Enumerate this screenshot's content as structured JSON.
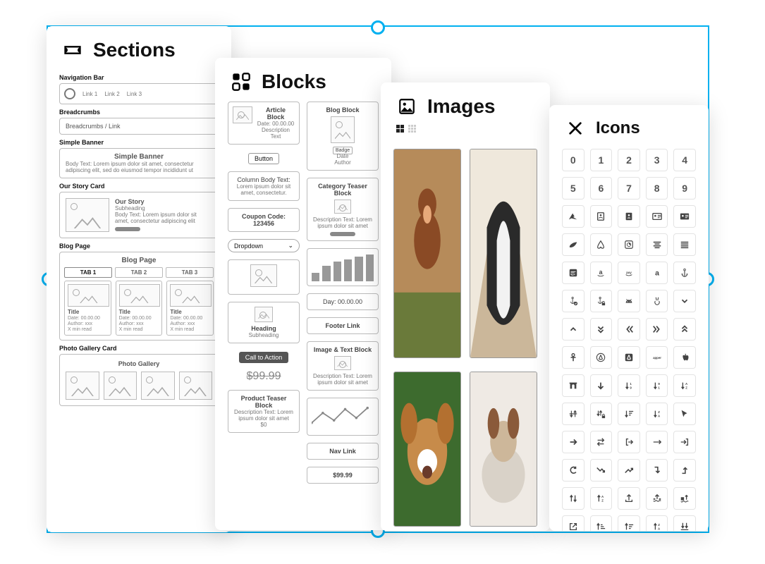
{
  "panels": {
    "sections": {
      "title": "Sections"
    },
    "blocks": {
      "title": "Blocks"
    },
    "images": {
      "title": "Images"
    },
    "icons": {
      "title": "Icons"
    }
  },
  "sections": {
    "nav": {
      "label": "Navigation Bar",
      "links": [
        "Link 1",
        "Link 2",
        "Link 3"
      ]
    },
    "breadcrumbs": {
      "label": "Breadcrumbs",
      "text": "Breadcrumbs / Link"
    },
    "banner": {
      "label": "Simple Banner",
      "heading": "Simple Banner",
      "body": "Body Text: Lorem ipsum dolor sit amet, consectetur adipiscing elit, sed do eiusmod tempor incididunt ut"
    },
    "story": {
      "label": "Our Story Card",
      "heading": "Our Story",
      "sub": "Subheading",
      "body": "Body Text: Lorem ipsum dolor sit amet, consectetur adipiscing elit"
    },
    "blog": {
      "label": "Blog Page",
      "heading": "Blog Page",
      "tabs": [
        "TAB 1",
        "TAB 2",
        "TAB 3"
      ],
      "card": {
        "title": "Title",
        "date": "Date: 00.00.00",
        "author": "Author: xxx",
        "read": "X min read"
      }
    },
    "gallery": {
      "label": "Photo Gallery Card",
      "heading": "Photo Gallery"
    }
  },
  "blocks": {
    "article": {
      "title": "Article Block",
      "date": "Date: 00.00.00",
      "desc": "Description Text"
    },
    "button": "Button",
    "column": {
      "title": "Column Body Text:",
      "body": "Lorem ipsum dolor sit amet, consectetur."
    },
    "coupon": "Coupon Code: 123456",
    "dropdown": "Dropdown",
    "heading": {
      "title": "Heading",
      "sub": "Subheading"
    },
    "cta": "Call to Action",
    "oldprice": "$99.99",
    "teaser": {
      "title": "Product Teaser Block",
      "desc": "Description Text: Lorem ipsum dolor sit amet",
      "price": "$0"
    },
    "blogblock": {
      "title": "Blog Block",
      "badge": "Badge",
      "date": "Date",
      "author": "Author"
    },
    "catteaser": {
      "title": "Category Teaser Block",
      "desc": "Description Text: Lorem ipsum dolor sit amet"
    },
    "day": "Day:  00.00.00",
    "footer": "Footer Link",
    "imgtext": {
      "title": "Image & Text Block",
      "desc": "Description Text: Lorem ipsum dolor sit amet"
    },
    "navlink": "Nav Link",
    "price": "$99.99"
  },
  "icons": {
    "rows": [
      [
        "0",
        "1",
        "2",
        "3",
        "4"
      ],
      [
        "5",
        "6",
        "7",
        "8",
        "9"
      ]
    ]
  }
}
